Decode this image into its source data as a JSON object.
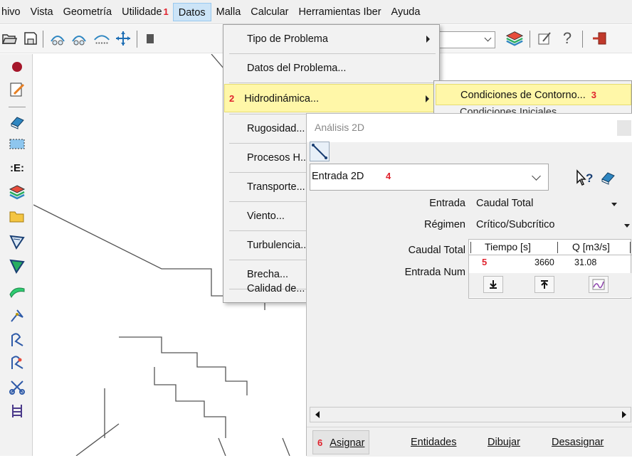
{
  "menubar": {
    "items": [
      "hivo",
      "Vista",
      "Geometría",
      "Utilidade",
      "Datos",
      "Malla",
      "Calcular",
      "Herramientas Iber",
      "Ayuda"
    ],
    "step_1": "1"
  },
  "datos_menu": {
    "items": [
      {
        "label": "Tipo de Problema",
        "submenu": true
      },
      {
        "label": "Datos del Problema...",
        "submenu": false
      },
      {
        "label": "Hidrodinámica...",
        "submenu": true,
        "step": "2"
      },
      {
        "label": "Rugosidad...",
        "submenu": false
      },
      {
        "label": "Procesos H...",
        "submenu": false
      },
      {
        "label": "Transporte...",
        "submenu": false
      },
      {
        "label": "Viento...",
        "submenu": false
      },
      {
        "label": "Turbulencia...",
        "submenu": false
      },
      {
        "label": "Brecha...",
        "submenu": false
      },
      {
        "label": "Calidad de...",
        "submenu": false
      }
    ]
  },
  "hidro_submenu": {
    "highlighted": "Condiciones de Contorno...",
    "step": "3",
    "next": "Condiciones Iniciales"
  },
  "dialog": {
    "title": "Análisis 2D",
    "condition_select": "Entrada 2D",
    "step_4": "4",
    "fields": [
      {
        "label": "Entrada",
        "value": "Caudal Total"
      },
      {
        "label": "Régimen",
        "value": "Crítico/Subcrítico"
      },
      {
        "label": "Caudal Total",
        "value": ""
      },
      {
        "label": "Entrada Num",
        "value": ""
      }
    ],
    "table": {
      "headers": [
        "Tiempo [s]",
        "Q [m3/s]"
      ],
      "row": {
        "step": "5",
        "tiempo": "3660",
        "q": "31.08"
      }
    },
    "buttons": {
      "step_6": "6",
      "asignar": "Asignar",
      "entidades": "Entidades",
      "dibujar": "Dibujar",
      "desasignar": "Desasignar"
    }
  },
  "colors": {
    "highlight": "#fff7a8",
    "step_red": "#e0222d",
    "menu_active": "#cce4f7"
  }
}
